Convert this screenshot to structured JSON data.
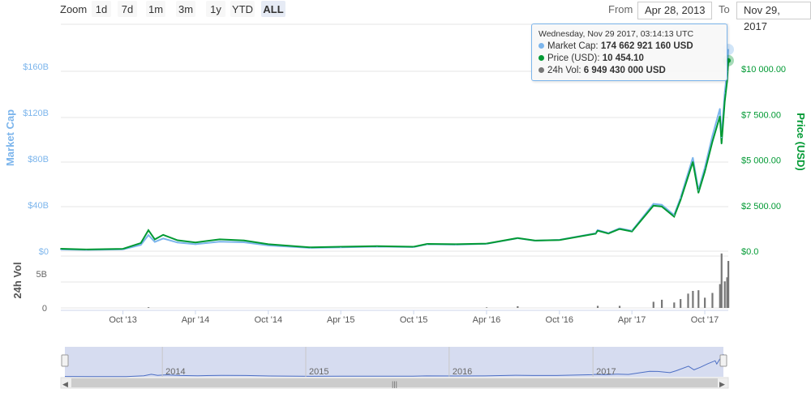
{
  "range_selector": {
    "zoom_label": "Zoom",
    "buttons": [
      "1d",
      "7d",
      "1m",
      "3m",
      "1y",
      "YTD",
      "ALL"
    ],
    "selected": "ALL",
    "from_label": "From",
    "from_value": "Apr 28, 2013",
    "to_label": "To",
    "to_value": "Nov 29, 2017"
  },
  "tooltip": {
    "header": "Wednesday, Nov 29 2017, 03:14:13 UTC",
    "rows": [
      {
        "label": "Market Cap:",
        "value": "174 662 921 160 USD",
        "color": "#7cb5ec"
      },
      {
        "label": "Price (USD):",
        "value": "10 454.10",
        "color": "#009933"
      },
      {
        "label": "24h Vol:",
        "value": "6 949 430 000 USD",
        "color": "#777777"
      }
    ]
  },
  "colors": {
    "market_cap": "#7cb5ec",
    "price": "#009933",
    "volume": "#777777",
    "navigator_fill": "#d6dcf0",
    "navigator_line": "#4d6fc4"
  },
  "chart_data": {
    "type": "line",
    "x_tick_labels": [
      "Oct '13",
      "Apr '14",
      "Oct '14",
      "Apr '15",
      "Oct '15",
      "Apr '16",
      "Oct '16",
      "Apr '17",
      "Oct '17"
    ],
    "x_ticks": [
      "2013-10-01",
      "2014-04-01",
      "2014-10-01",
      "2015-04-01",
      "2015-10-01",
      "2016-04-01",
      "2016-10-01",
      "2017-04-01",
      "2017-10-01"
    ],
    "x_range": [
      "2013-04-28",
      "2017-11-29"
    ],
    "left_axis": {
      "label": "Market Cap",
      "ticks": [
        "$0",
        "$40B",
        "$80B",
        "$120B",
        "$160B"
      ],
      "range": [
        0,
        160
      ]
    },
    "right_axis": {
      "label": "Price (USD)",
      "ticks": [
        "$0.0",
        "$2 500.00",
        "$5 000.00",
        "$7 500.00",
        "$10 000.00"
      ],
      "range": [
        0,
        10000
      ]
    },
    "volume_axis": {
      "label": "24h Vol",
      "ticks": [
        "0",
        "5B"
      ],
      "range": [
        0,
        5
      ]
    },
    "navigator_labels": [
      "2014",
      "2015",
      "2016",
      "2017"
    ],
    "series": [
      {
        "name": "Price (USD)",
        "axis": "right",
        "points": [
          [
            "2013-04-28",
            135
          ],
          [
            "2013-07-01",
            95
          ],
          [
            "2013-10-01",
            130
          ],
          [
            "2013-11-15",
            450
          ],
          [
            "2013-12-04",
            1150
          ],
          [
            "2013-12-20",
            650
          ],
          [
            "2014-01-10",
            900
          ],
          [
            "2014-02-15",
            600
          ],
          [
            "2014-04-01",
            480
          ],
          [
            "2014-06-01",
            650
          ],
          [
            "2014-08-01",
            590
          ],
          [
            "2014-10-01",
            380
          ],
          [
            "2015-01-15",
            210
          ],
          [
            "2015-04-01",
            245
          ],
          [
            "2015-07-01",
            275
          ],
          [
            "2015-10-01",
            245
          ],
          [
            "2015-11-04",
            400
          ],
          [
            "2016-01-15",
            380
          ],
          [
            "2016-04-01",
            420
          ],
          [
            "2016-06-18",
            720
          ],
          [
            "2016-08-01",
            580
          ],
          [
            "2016-10-01",
            615
          ],
          [
            "2016-12-31",
            960
          ],
          [
            "2017-01-05",
            1130
          ],
          [
            "2017-02-01",
            970
          ],
          [
            "2017-03-01",
            1220
          ],
          [
            "2017-04-01",
            1080
          ],
          [
            "2017-05-25",
            2500
          ],
          [
            "2017-06-15",
            2450
          ],
          [
            "2017-07-16",
            1900
          ],
          [
            "2017-08-01",
            2800
          ],
          [
            "2017-09-01",
            4900
          ],
          [
            "2017-09-15",
            3200
          ],
          [
            "2017-10-01",
            4350
          ],
          [
            "2017-10-20",
            6000
          ],
          [
            "2017-11-08",
            7400
          ],
          [
            "2017-11-12",
            5900
          ],
          [
            "2017-11-20",
            8200
          ],
          [
            "2017-11-26",
            9300
          ],
          [
            "2017-11-29",
            10454.1
          ]
        ]
      },
      {
        "name": "Market Cap",
        "axis": "left",
        "points": [
          [
            "2013-04-28",
            1.5
          ],
          [
            "2013-07-01",
            1.1
          ],
          [
            "2013-10-01",
            1.6
          ],
          [
            "2013-11-15",
            5.5
          ],
          [
            "2013-12-04",
            14
          ],
          [
            "2013-12-20",
            8
          ],
          [
            "2014-01-10",
            11
          ],
          [
            "2014-02-15",
            7.5
          ],
          [
            "2014-04-01",
            6
          ],
          [
            "2014-06-01",
            8.3
          ],
          [
            "2014-08-01",
            7.7
          ],
          [
            "2014-10-01",
            5
          ],
          [
            "2015-01-15",
            2.9
          ],
          [
            "2015-04-01",
            3.4
          ],
          [
            "2015-07-01",
            3.9
          ],
          [
            "2015-10-01",
            3.6
          ],
          [
            "2015-11-04",
            6
          ],
          [
            "2016-01-15",
            5.7
          ],
          [
            "2016-04-01",
            6.4
          ],
          [
            "2016-06-18",
            11.2
          ],
          [
            "2016-08-01",
            9.1
          ],
          [
            "2016-10-01",
            9.8
          ],
          [
            "2016-12-31",
            15.5
          ],
          [
            "2017-01-05",
            18.3
          ],
          [
            "2017-02-01",
            15.7
          ],
          [
            "2017-03-01",
            19.8
          ],
          [
            "2017-04-01",
            17.6
          ],
          [
            "2017-05-25",
            41
          ],
          [
            "2017-06-15",
            40.2
          ],
          [
            "2017-07-16",
            31.3
          ],
          [
            "2017-08-01",
            46.2
          ],
          [
            "2017-09-01",
            81
          ],
          [
            "2017-09-15",
            53
          ],
          [
            "2017-10-01",
            72.1
          ],
          [
            "2017-10-20",
            99.8
          ],
          [
            "2017-11-08",
            123.4
          ],
          [
            "2017-11-12",
            98.5
          ],
          [
            "2017-11-20",
            137
          ],
          [
            "2017-11-26",
            155.5
          ],
          [
            "2017-11-29",
            174.66
          ]
        ]
      },
      {
        "name": "24h Vol",
        "axis": "volume",
        "type": "bar",
        "points": [
          [
            "2013-12-04",
            0.1
          ],
          [
            "2016-04-01",
            0.08
          ],
          [
            "2016-06-18",
            0.25
          ],
          [
            "2017-01-05",
            0.3
          ],
          [
            "2017-03-01",
            0.3
          ],
          [
            "2017-05-25",
            0.9
          ],
          [
            "2017-06-15",
            1.2
          ],
          [
            "2017-07-16",
            0.8
          ],
          [
            "2017-08-01",
            1.3
          ],
          [
            "2017-08-20",
            2.1
          ],
          [
            "2017-09-01",
            2.5
          ],
          [
            "2017-09-15",
            2.6
          ],
          [
            "2017-10-01",
            1.5
          ],
          [
            "2017-10-20",
            2.2
          ],
          [
            "2017-11-08",
            3.5
          ],
          [
            "2017-11-12",
            8.0
          ],
          [
            "2017-11-20",
            3.9
          ],
          [
            "2017-11-26",
            4.5
          ],
          [
            "2017-11-29",
            6.9
          ]
        ]
      }
    ]
  }
}
